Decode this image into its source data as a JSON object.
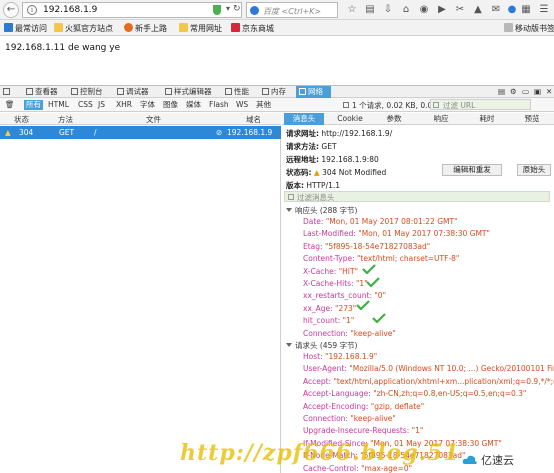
{
  "browser": {
    "url": "192.168.1.9",
    "search_placeholder": "百度 <Ctrl+K>"
  },
  "bookmarks": [
    {
      "label": "最常访问",
      "icon": "star-icon"
    },
    {
      "label": "火狐官方站点",
      "icon": "folder-icon"
    },
    {
      "label": "新手上路",
      "icon": "firefox-icon"
    },
    {
      "label": "常用网址",
      "icon": "folder-icon"
    },
    {
      "label": "京东商城",
      "icon": "jd-icon"
    }
  ],
  "bookmarks_right": "移动版书签",
  "page": {
    "body_text": "192.168.1.11 de wang ye"
  },
  "devtools": {
    "tabs": [
      "查看器",
      "控制台",
      "调试器",
      "样式编辑器",
      "性能",
      "内存",
      "网络"
    ],
    "active_tab": "网络",
    "filters": [
      "所有",
      "HTML",
      "CSS",
      "JS",
      "XHR",
      "字体",
      "图像",
      "媒体",
      "Flash",
      "WS",
      "其他"
    ],
    "active_filter": "所有",
    "stats": "1 个请求, 0.02 KB, 0.00 秒",
    "url_filter_placeholder": "过滤 URL",
    "columns": [
      "状态",
      "方法",
      "文件",
      "域名"
    ],
    "request": {
      "status": "304",
      "method": "GET",
      "file": "/",
      "domain": "192.168.1.9"
    },
    "detail_tabs": [
      "消息头",
      "Cookie",
      "参数",
      "响应",
      "耗时",
      "预览"
    ],
    "active_detail_tab": "消息头"
  },
  "summary": {
    "request_url_label": "请求网址:",
    "request_url": "http://192.168.1.9/",
    "request_method_label": "请求方法:",
    "request_method": "GET",
    "remote_addr_label": "远程地址:",
    "remote_addr": "192.168.1.9:80",
    "status_label": "状态码:",
    "status": "304 Not Modified",
    "version_label": "版本:",
    "version": "HTTP/1.1",
    "edit_resend": "编辑和重发",
    "raw_headers": "原始头",
    "header_filter_placeholder": "过滤消息头"
  },
  "response_headers": {
    "title": "响应头 (288 字节)",
    "items": [
      {
        "key": "Date:",
        "value": "\"Mon, 01 May 2017 08:01:22 GMT\""
      },
      {
        "key": "Last-Modified:",
        "value": "\"Mon, 01 May 2017 07:38:30 GMT\""
      },
      {
        "key": "Etag:",
        "value": "\"5f895-18-54e71827083ad\""
      },
      {
        "key": "Content-Type:",
        "value": "\"text/html; charset=UTF-8\""
      },
      {
        "key": "X-Cache:",
        "value": "\"HIT\""
      },
      {
        "key": "X-Cache-Hits:",
        "value": "\"1\""
      },
      {
        "key": "xx_restarts_count:",
        "value": "\"0\""
      },
      {
        "key": "xx_Age:",
        "value": "\"273\""
      },
      {
        "key": "hit_count:",
        "value": "\"1\""
      },
      {
        "key": "Connection:",
        "value": "\"keep-alive\""
      }
    ]
  },
  "request_headers": {
    "title": "请求头 (459 字节)",
    "items": [
      {
        "key": "Host:",
        "value": "\"192.168.1.9\""
      },
      {
        "key": "User-Agent:",
        "value": "\"Mozilla/5.0 (Windows NT 10.0; ...) Gecko/20100101 Firefox/53\""
      },
      {
        "key": "Accept:",
        "value": "\"text/html,application/xhtml+xm...plication/xml;q=0.9,*/*;q=0.8\""
      },
      {
        "key": "Accept-Language:",
        "value": "\"zh-CN,zh;q=0.8,en-US;q=0.5,en;q=0.3\""
      },
      {
        "key": "Accept-Encoding:",
        "value": "\"gzip, deflate\""
      },
      {
        "key": "Connection:",
        "value": "\"keep-alive\""
      },
      {
        "key": "Upgrade-Insecure-Requests:",
        "value": "\"1\""
      },
      {
        "key": "If-Modified-Since:",
        "value": "\"Mon, 01 May 2017 07:38:30 GMT\""
      },
      {
        "key": "If-None-Match:",
        "value": "\"5f895-18-54e71827083ad\""
      },
      {
        "key": "Cache-Control:",
        "value": "\"max-age=0\""
      }
    ]
  },
  "watermark": "http://zpf666.blog.51",
  "logo_text": "亿速云"
}
